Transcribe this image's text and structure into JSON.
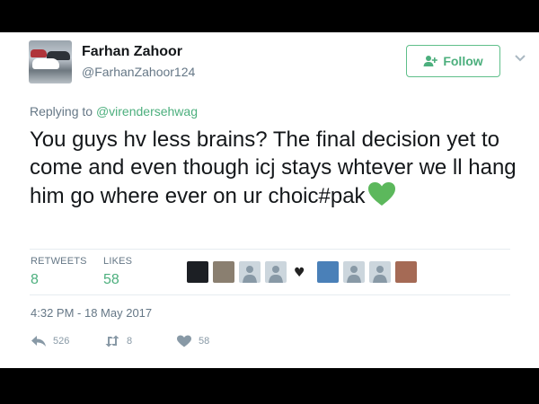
{
  "user": {
    "display_name": "Farhan Zahoor",
    "handle": "@FarhanZahoor124",
    "avatar_icon": "avatar-photo-cars"
  },
  "follow_button": {
    "label": "Follow",
    "icon": "add-user-icon"
  },
  "menu_caret_icon": "chevron-down-icon",
  "reply": {
    "prefix": "Replying to",
    "mention": "@virendersehwag"
  },
  "tweet": {
    "text": "You guys hv less brains?  The final decision yet to come and even though icj stays whtever we ll hang him go where ever on ur choic#pak",
    "emoji": "green-heart"
  },
  "stats": {
    "retweets_label": "RETWEETS",
    "retweets_value": "8",
    "likes_label": "LIKES",
    "likes_value": "58"
  },
  "likers": [
    "#1c1f24",
    "#8a7f70",
    "#ccd6dd",
    "#ccd6dd",
    "#ffffff",
    "#4a80b8",
    "#ccd6dd",
    "#ccd6dd",
    "#a56a55"
  ],
  "timestamp": "4:32 PM - 18 May 2017",
  "actions": {
    "reply_count": "526",
    "retweet_count": "8",
    "like_count": "58"
  },
  "colors": {
    "accent": "#4caf7d",
    "text": "#14171a",
    "muted": "#657786",
    "heart": "#5cb85c"
  }
}
